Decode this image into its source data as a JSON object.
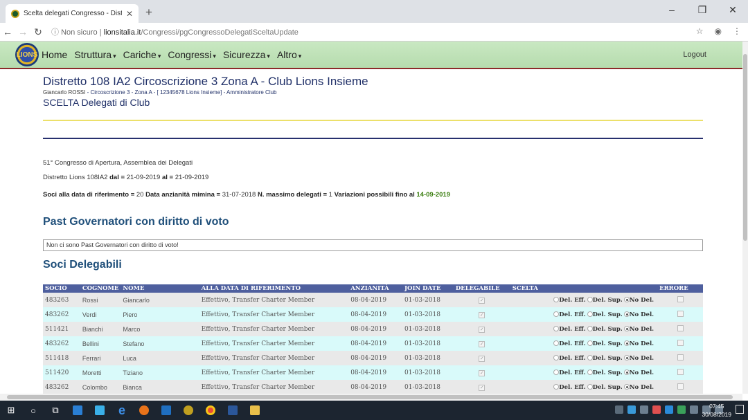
{
  "browser": {
    "tab_title": "Scelta delegati Congresso - Dist",
    "url_security": "Non sicuro",
    "url_host": "lionsitalia.it",
    "url_path": "/Congressi/pgCongressoDelegatiSceltaUpdate"
  },
  "navbar": {
    "logo_text": "LIONS",
    "items": [
      "Home",
      "Struttura",
      "Cariche",
      "Congressi",
      "Sicurezza",
      "Altro"
    ],
    "logout": "Logout"
  },
  "header": {
    "title": "Distretto 108 IA2 Circoscrizione 3 Zona A - Club",
    "club": "Lions Insieme",
    "user": "Giancarlo ROSSI",
    "sub": "- Circoscrizione 3 - Zona A - [ 12345678 Lions Insieme] - Amministratore Club",
    "section": "SCELTA Delegati di Club"
  },
  "info": {
    "congresso": "51° Congresso di Apertura, Assemblea dei Delegati",
    "distretto_prefix": "Distretto Lions 108IA2",
    "dal_label": "dal =",
    "dal": "21-09-2019",
    "al_label": "al =",
    "al": "21-09-2019",
    "soci_label": "Soci alla data di riferimento =",
    "soci": "20",
    "anz_label": "Data anzianità mimina =",
    "anz": "31-07-2018",
    "max_label": "N. massimo delegati =",
    "max": "1",
    "var_label": "Variazioni possibili fino al",
    "var": "14-09-2019"
  },
  "past": {
    "title": "Past Governatori con diritto di voto",
    "empty": "Non ci sono Past Governatori con diritto di voto!"
  },
  "soci": {
    "title": "Soci Delegabili",
    "headers": [
      "SOCIO",
      "COGNOME",
      "NOME",
      "ALLA DATA DI RIFERIMENTO",
      "ANZIANITÀ",
      "JOIN DATE",
      "DELEGABILE",
      "SCELTA",
      "ERRORE"
    ],
    "options": [
      "Del. Eff.",
      "Del. Sup.",
      "No Del."
    ],
    "rows": [
      {
        "socio": "483263",
        "cognome": "Rossi",
        "nome": "Giancarlo",
        "rif": "Effettivo, Transfer Charter Member",
        "anz": "08-04-2019",
        "join": "01-03-2018"
      },
      {
        "socio": "483262",
        "cognome": "Verdi",
        "nome": "Piero",
        "rif": "Effettivo, Transfer Charter Member",
        "anz": "08-04-2019",
        "join": "01-03-2018"
      },
      {
        "socio": "511421",
        "cognome": "Bianchi",
        "nome": "Marco",
        "rif": "Effettivo, Transfer Charter Member",
        "anz": "08-04-2019",
        "join": "01-03-2018"
      },
      {
        "socio": "483262",
        "cognome": "Bellini",
        "nome": "Stefano",
        "rif": "Effettivo, Transfer Charter Member",
        "anz": "08-04-2019",
        "join": "01-03-2018"
      },
      {
        "socio": "511418",
        "cognome": "Ferrari",
        "nome": "Luca",
        "rif": "Effettivo, Transfer Charter Member",
        "anz": "08-04-2019",
        "join": "01-03-2018"
      },
      {
        "socio": "511420",
        "cognome": "Moretti",
        "nome": "Tiziano",
        "rif": "Effettivo, Transfer Charter Member",
        "anz": "08-04-2019",
        "join": "01-03-2018"
      },
      {
        "socio": "483262",
        "cognome": "Colombo",
        "nome": "Bianca",
        "rif": "Effettivo, Transfer Charter Member",
        "anz": "08-04-2019",
        "join": "01-03-2018"
      }
    ]
  },
  "taskbar": {
    "time": "07:45",
    "date": "30/08/2019"
  }
}
